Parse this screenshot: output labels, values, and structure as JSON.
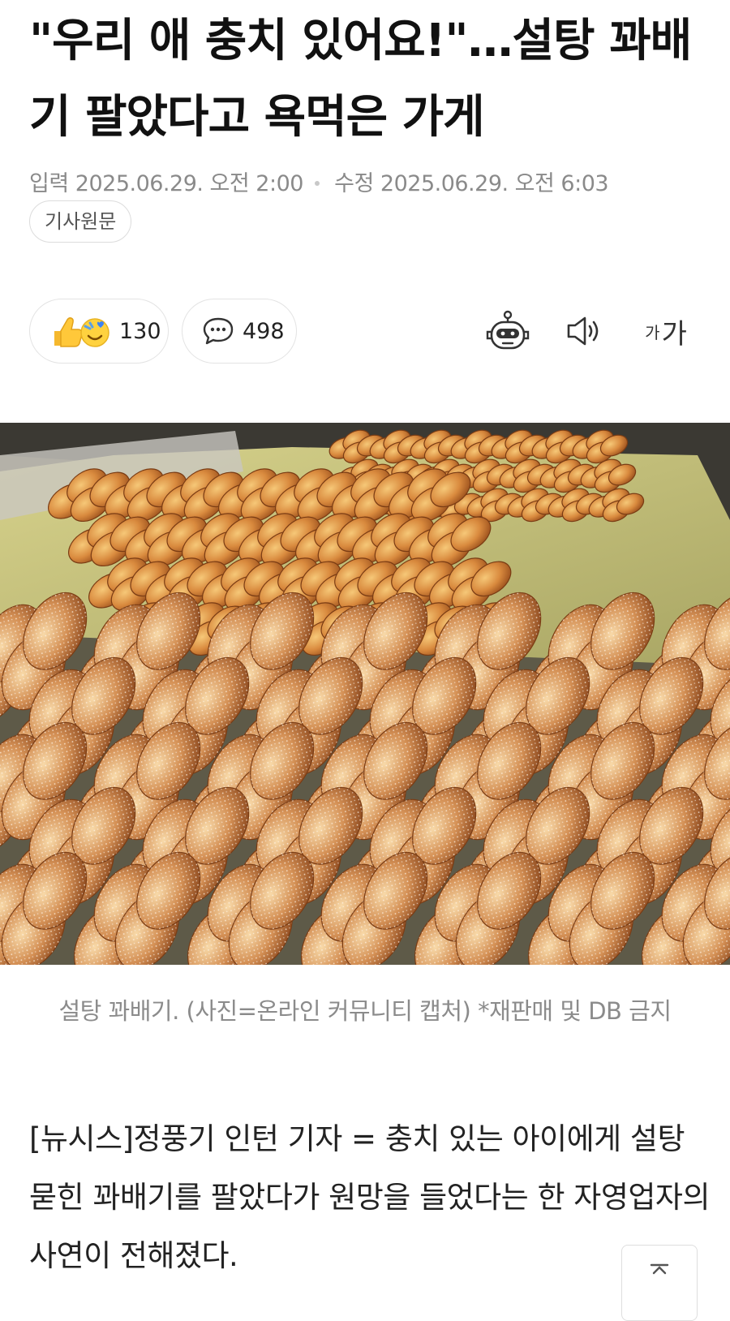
{
  "article": {
    "title": "\"우리 애 충치 있어요!\"…설탕 꽈배기 팔았다고 욕먹은 가게",
    "input_label": "입력",
    "input_time": "2025.06.29. 오전 2:00",
    "modified_label": "수정",
    "modified_time": "2025.06.29. 오전 6:03",
    "original_button": "기사원문",
    "caption": "설탕 꽈배기. (사진=온라인 커뮤니티 캡처) *재판매 및 DB 금지",
    "body": "[뉴시스]정풍기 인턴 기자 = 충치 있는 아이에게 설탕 묻힌 꽈배기를 팔았다가 원망을 들었다는 한 자영업자의 사연이 전해졌다."
  },
  "actions": {
    "reaction_count": "130",
    "comment_count": "498",
    "font_small": "가",
    "font_large": "가"
  },
  "icons": {
    "reaction": "thumbs-up-emoji-icon",
    "comment": "speech-bubble-icon",
    "summary": "robot-icon",
    "tts": "speaker-icon",
    "font": "font-size-icon",
    "top": "scroll-top-icon"
  },
  "colors": {
    "text": "#111111",
    "meta": "#8a8a8a",
    "caption": "#8b8b8b",
    "border": "#e3e3e3"
  }
}
